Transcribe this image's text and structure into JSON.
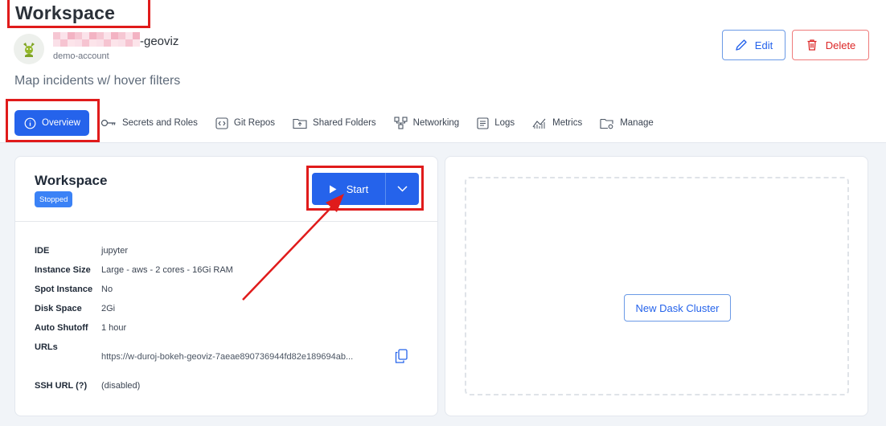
{
  "header": {
    "title": "Workspace",
    "workspace_name_suffix": "-geoviz",
    "account": "demo-account",
    "description": "Map incidents w/ hover filters",
    "edit_label": "Edit",
    "delete_label": "Delete"
  },
  "tabs": [
    {
      "label": "Overview",
      "icon": "info-icon",
      "active": true
    },
    {
      "label": "Secrets and Roles",
      "icon": "key-icon"
    },
    {
      "label": "Git Repos",
      "icon": "code-icon"
    },
    {
      "label": "Shared Folders",
      "icon": "folder-icon"
    },
    {
      "label": "Networking",
      "icon": "network-icon"
    },
    {
      "label": "Logs",
      "icon": "document-icon"
    },
    {
      "label": "Metrics",
      "icon": "metrics-icon"
    },
    {
      "label": "Manage",
      "icon": "folder-gear-icon"
    }
  ],
  "workspace_card": {
    "title": "Workspace",
    "status": "Stopped",
    "start_label": "Start",
    "details": [
      {
        "label": "IDE",
        "value": "jupyter"
      },
      {
        "label": "Instance Size",
        "value": "Large - aws - 2 cores - 16Gi RAM"
      },
      {
        "label": "Spot Instance",
        "value": "No"
      },
      {
        "label": "Disk Space",
        "value": "2Gi"
      },
      {
        "label": "Auto Shutoff",
        "value": "1 hour"
      },
      {
        "label": "URLs",
        "value": ""
      },
      {
        "label": "SSH URL (?)",
        "value": "(disabled)"
      }
    ],
    "url_value": "https://w-duroj-bokeh-geoviz-7aeae890736944fd82e189694ab..."
  },
  "dask_card": {
    "button_label": "New Dask Cluster"
  },
  "colors": {
    "accent": "#2563eb",
    "danger": "#dc2626",
    "highlight": "#e01b1b"
  }
}
